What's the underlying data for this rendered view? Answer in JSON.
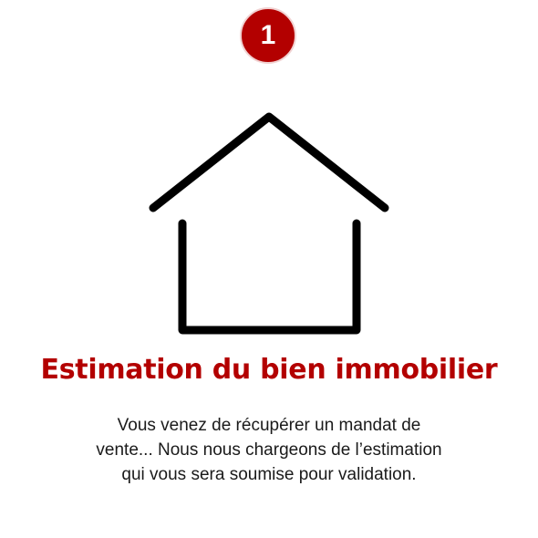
{
  "step": {
    "number": "1",
    "color": "#b30000"
  },
  "icon": {
    "name": "house-icon"
  },
  "title": "Estimation du bien immobilier",
  "description": {
    "lines": [
      "Vous venez de récupérer un mandat de",
      "vente... Nous nous chargeons de l’estimation",
      "qui vous sera soumise pour validation."
    ]
  }
}
